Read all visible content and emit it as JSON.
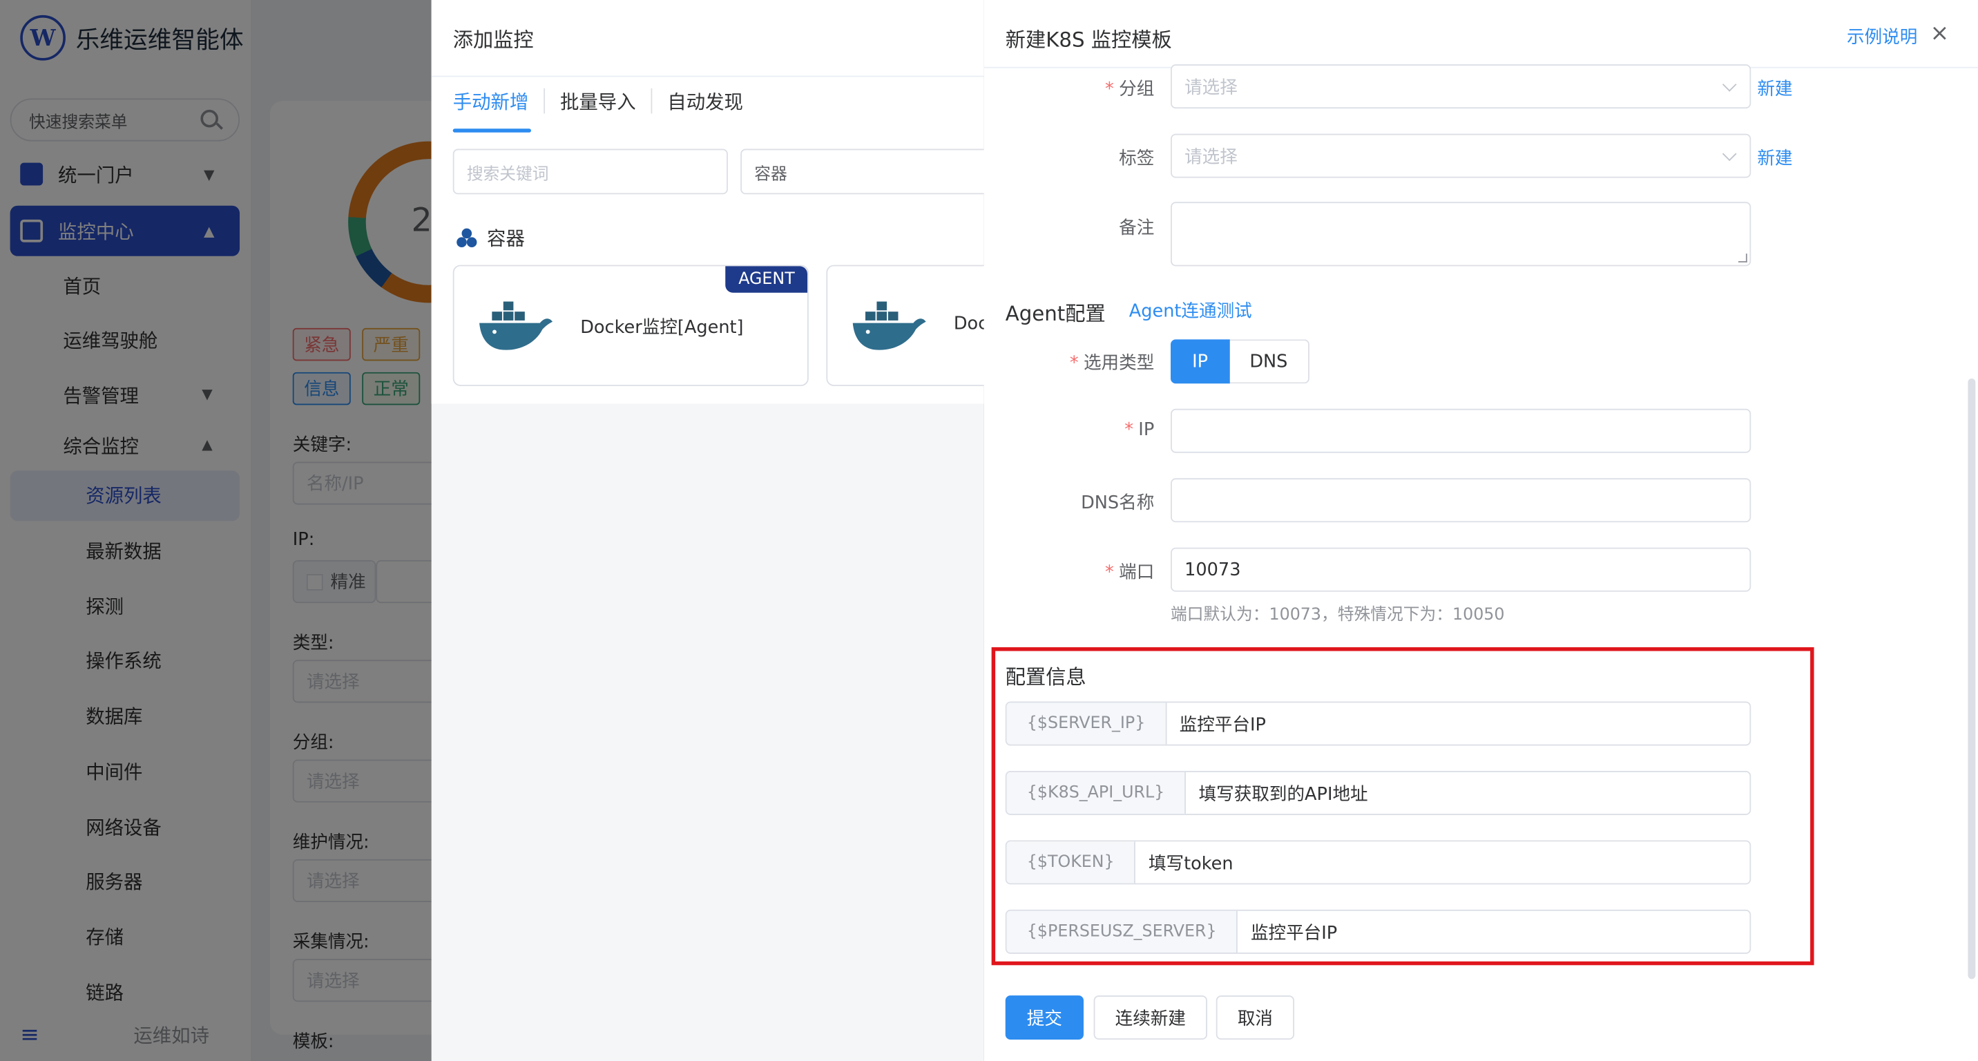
{
  "app": {
    "name": "乐维运维智能体"
  },
  "sidebar": {
    "search_placeholder": "快速搜索菜单",
    "items": [
      {
        "label": "统一门户"
      },
      {
        "label": "监控中心"
      }
    ],
    "sub_items": [
      "首页",
      "运维驾驶舱",
      "告警管理",
      "综合监控"
    ],
    "sub_sub_items": [
      "资源列表",
      "最新数据",
      "探测",
      "操作系统",
      "数据库",
      "中间件",
      "网络设备",
      "服务器",
      "存储",
      "链路"
    ],
    "bottom_text": "运维如诗"
  },
  "background": {
    "donut_number": "2",
    "tags": [
      "紧急",
      "严重",
      "信息",
      "正常"
    ],
    "filter_labels": [
      "关键字:",
      "IP:",
      "类型:",
      "分组:",
      "维护情况:",
      "采集情况:",
      "模板:"
    ],
    "filter_placeholders": [
      "名称/IP",
      "请选择",
      "请选择",
      "请选择",
      "请选择"
    ],
    "exact_label": "精准"
  },
  "add_monitor": {
    "title": "添加监控",
    "tabs": [
      "手动新增",
      "批量导入",
      "自动发现"
    ],
    "search_placeholder": "搜索关键词",
    "type_select": "容器",
    "category": "容器",
    "cards": [
      {
        "name": "Docker监控[Agent]",
        "badge": "AGENT"
      },
      {
        "name": "Doc"
      }
    ]
  },
  "k8s_form": {
    "title": "新建K8S 监控模板",
    "help_link": "示例说明",
    "close": "×",
    "group": {
      "label": "分组",
      "placeholder": "请选择",
      "new": "新建"
    },
    "tag": {
      "label": "标签",
      "placeholder": "请选择",
      "new": "新建"
    },
    "remark": {
      "label": "备注",
      "value": ""
    },
    "agent_section": {
      "title": "Agent配置",
      "test_link": "Agent连通测试"
    },
    "type": {
      "label": "选用类型",
      "options": [
        "IP",
        "DNS"
      ],
      "selected": "IP"
    },
    "ip": {
      "label": "IP",
      "value": ""
    },
    "dns": {
      "label": "DNS名称",
      "value": ""
    },
    "port": {
      "label": "端口",
      "value": "10073",
      "hint": "端口默认为：10073，特殊情况下为：10050"
    },
    "config_section": {
      "title": "配置信息",
      "rows": [
        {
          "key": "{$SERVER_IP}",
          "value": "监控平台IP"
        },
        {
          "key": "{$K8S_API_URL}",
          "value": "填写获取到的API地址"
        },
        {
          "key": "{$TOKEN}",
          "value": "填写token"
        },
        {
          "key": "{$PERSEUSZ_SERVER}",
          "value": "监控平台IP"
        }
      ],
      "highlight_color": "#e0161d"
    },
    "buttons": {
      "submit": "提交",
      "continue": "连续新建",
      "cancel": "取消"
    }
  },
  "colors": {
    "primary": "#2d8cf0",
    "nav_active": "#2b4ecb",
    "required": "#f56c6c"
  }
}
